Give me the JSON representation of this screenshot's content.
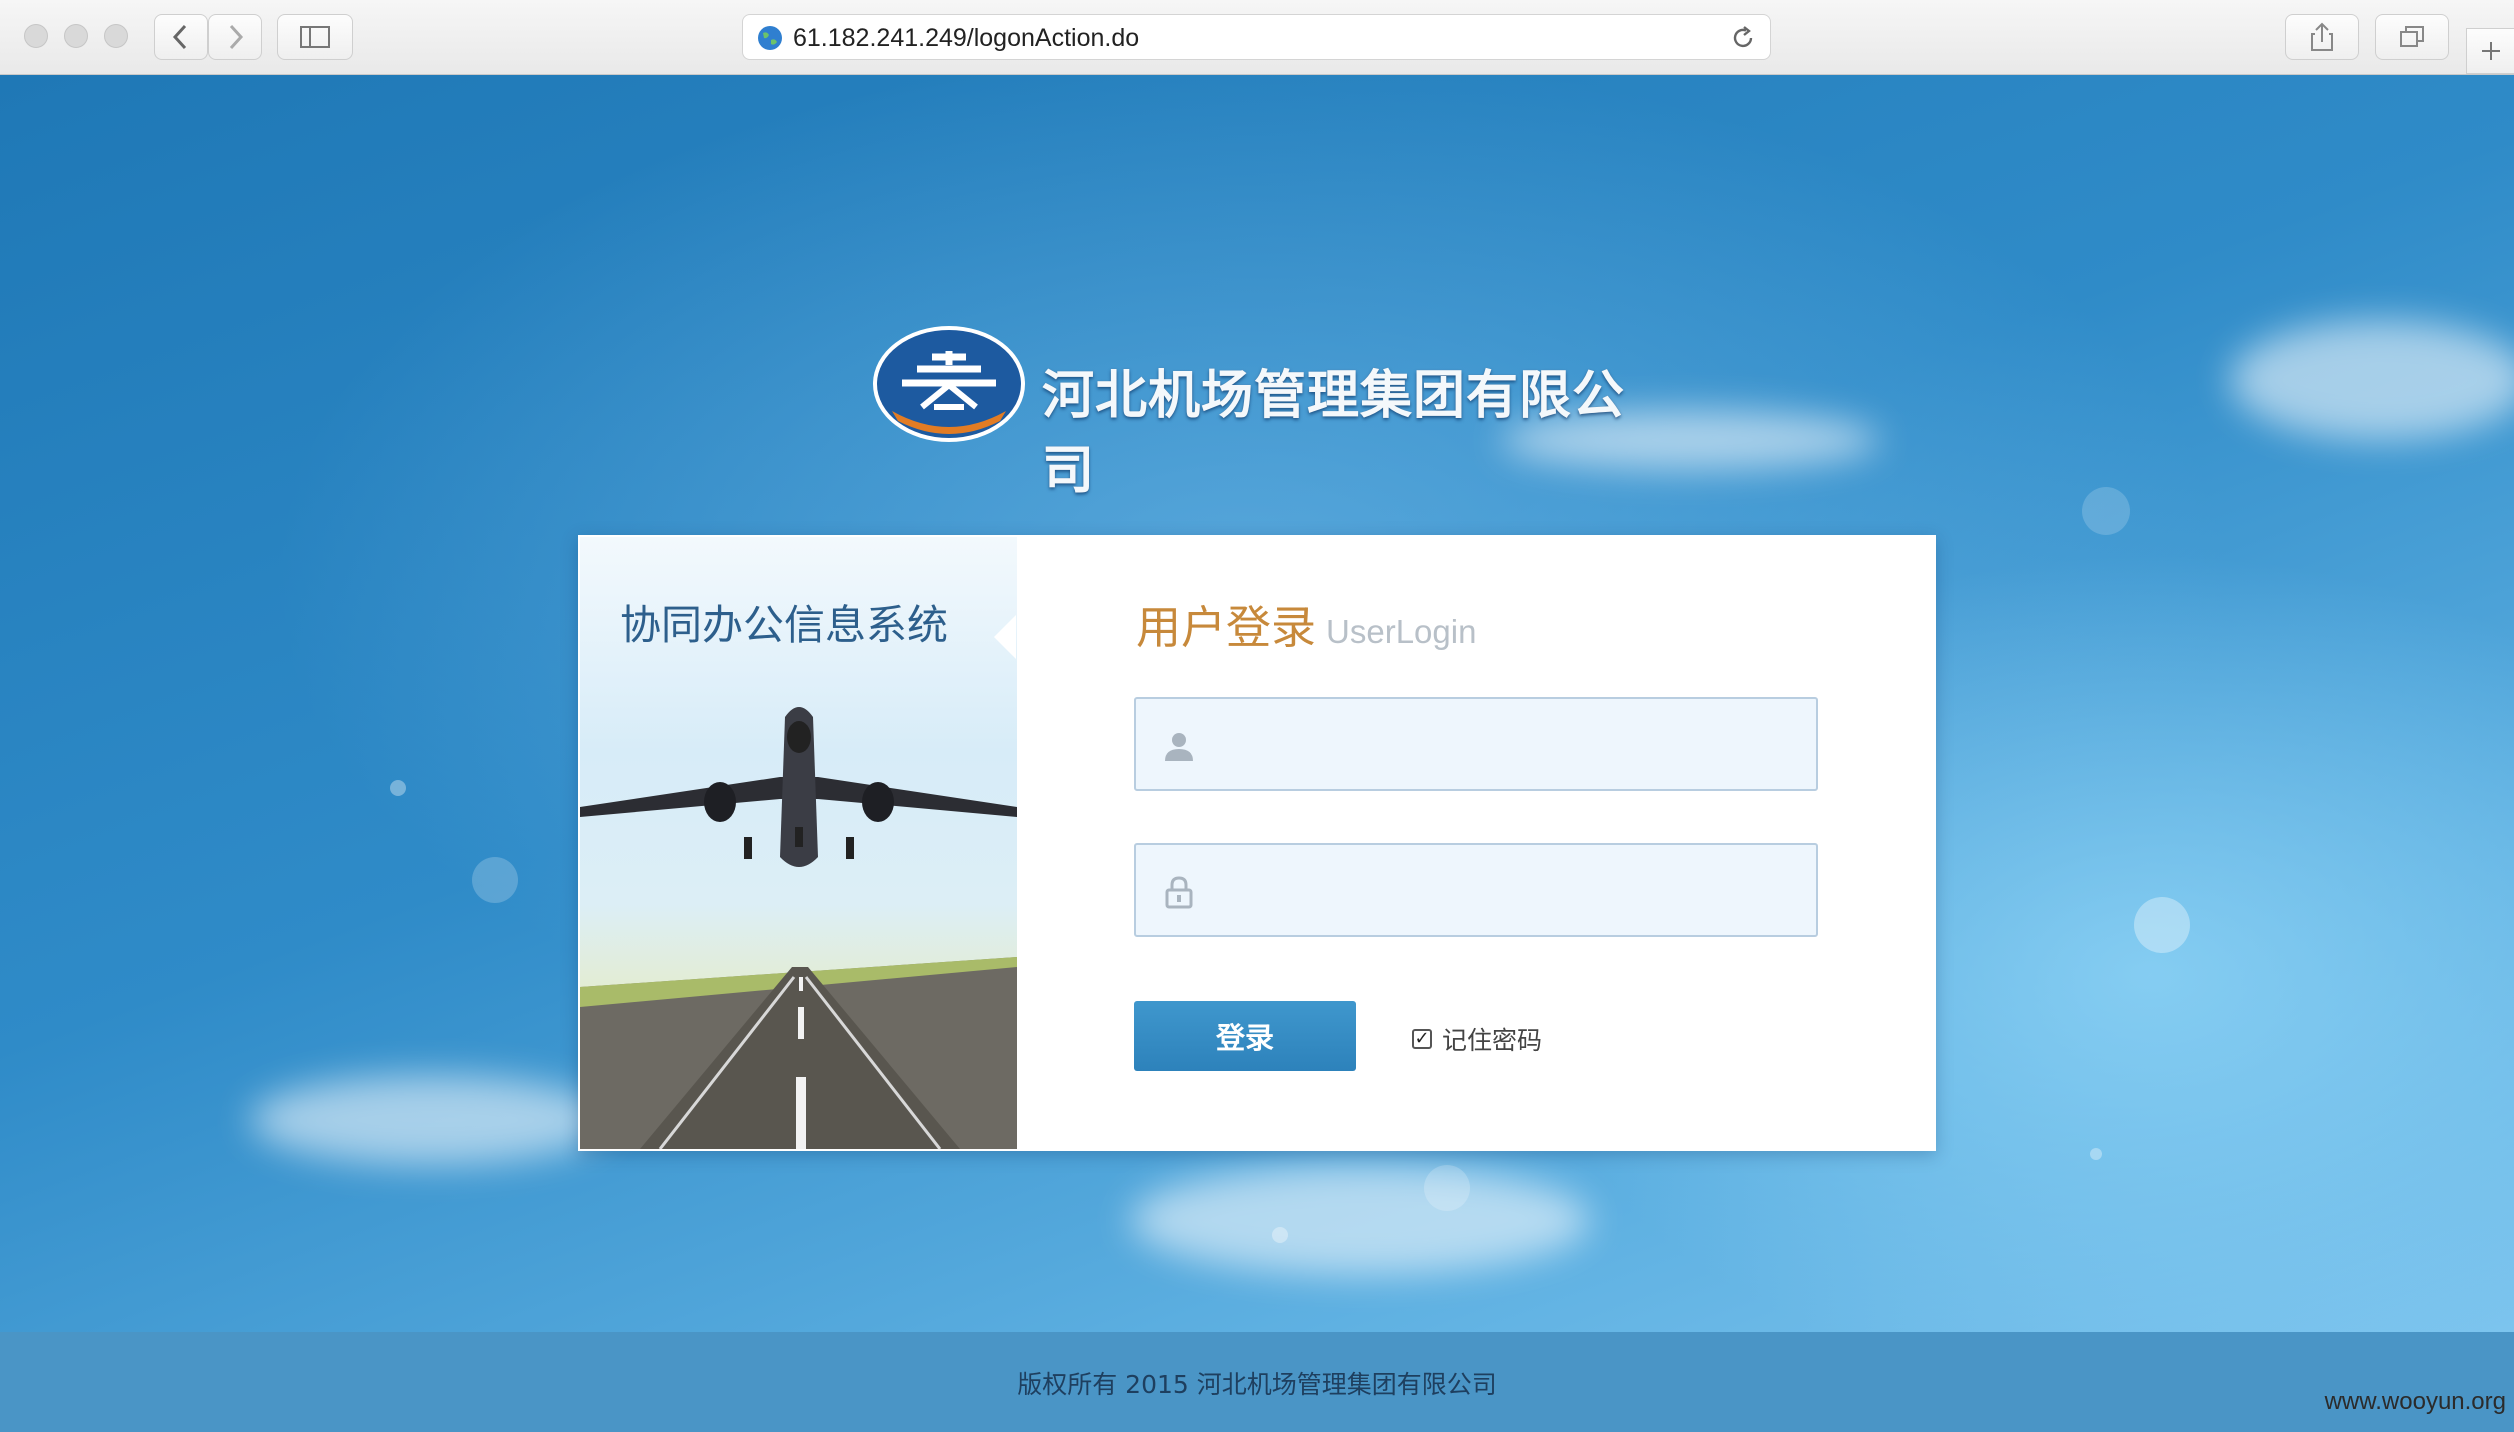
{
  "browser": {
    "url": "61.182.241.249/logonAction.do"
  },
  "page": {
    "company_name": "河北机场管理集团有限公司",
    "system_title": "协同办公信息系统",
    "login": {
      "title_cn": "用户登录",
      "title_en": "UserLogin",
      "username_value": "",
      "password_value": "",
      "submit_label": "登录",
      "remember_label": "记住密码",
      "remember_checked": true
    },
    "footer": "版权所有 2015 河北机场管理集团有限公司",
    "watermark": "www.wooyun.org"
  },
  "icons": {
    "globe": "globe-icon",
    "reload": "reload-icon",
    "user": "user-icon",
    "lock": "lock-icon",
    "back": "chevron-left-icon",
    "forward": "chevron-right-icon",
    "sidebar": "sidebar-icon",
    "share": "share-icon",
    "tabs": "tabs-icon",
    "new_tab": "plus-icon"
  },
  "colors": {
    "accent_blue": "#2d82bb",
    "title_orange": "#c7893b",
    "system_title_blue": "#2d5f8c"
  }
}
